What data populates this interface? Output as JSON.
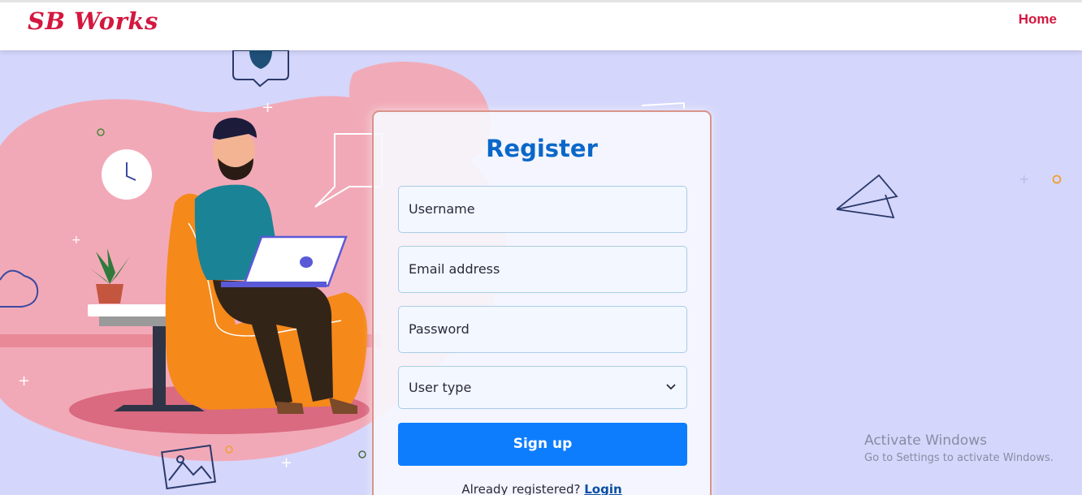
{
  "navbar": {
    "brand": "SB Works",
    "home_label": "Home"
  },
  "form": {
    "title": "Register",
    "username_placeholder": "Username",
    "email_placeholder": "Email address",
    "password_placeholder": "Password",
    "user_type_selected": "User type",
    "signup_label": "Sign up",
    "already_text": "Already registered?",
    "login_link": "Login"
  },
  "watermark": {
    "title": "Activate Windows",
    "subtitle": "Go to Settings to activate Windows."
  },
  "colors": {
    "brand": "#d4173f",
    "accent_blue": "#0d7dfd",
    "title_blue": "#0a67c9",
    "background": "#d4d6fb"
  }
}
